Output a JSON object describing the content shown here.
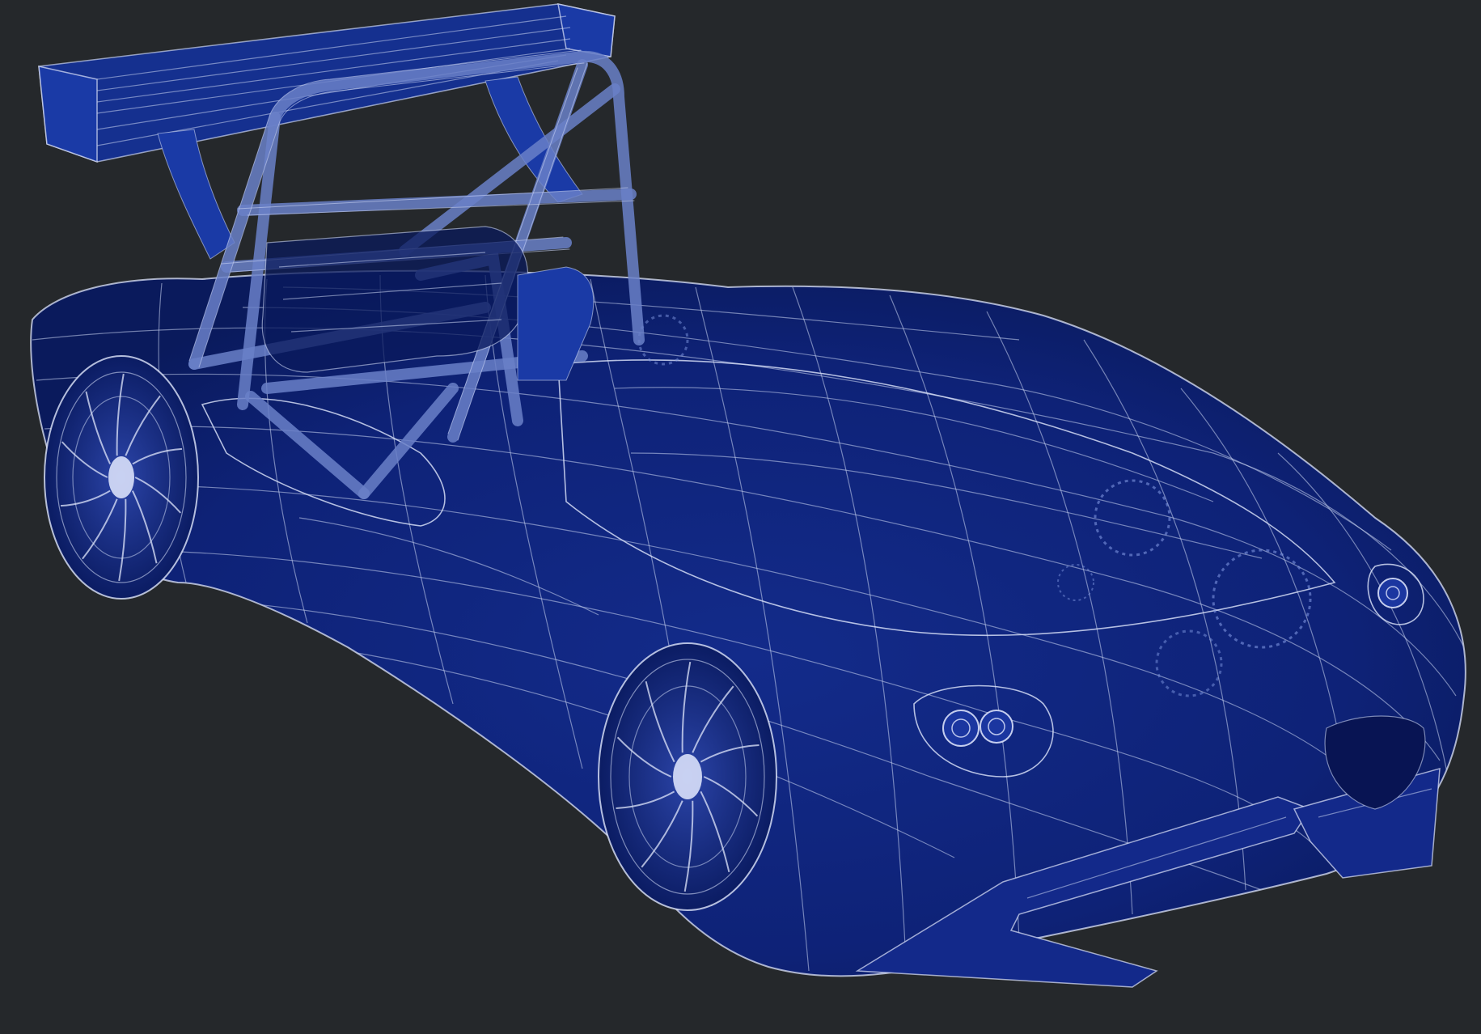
{
  "viewport": {
    "background_color": "#25282b",
    "surface_color": "#0f237a",
    "surface_dark_color": "#0a1a5c",
    "wire_color": "#c9d3f0",
    "frame_color": "#6a80c8",
    "model": "wireframe-race-car"
  }
}
